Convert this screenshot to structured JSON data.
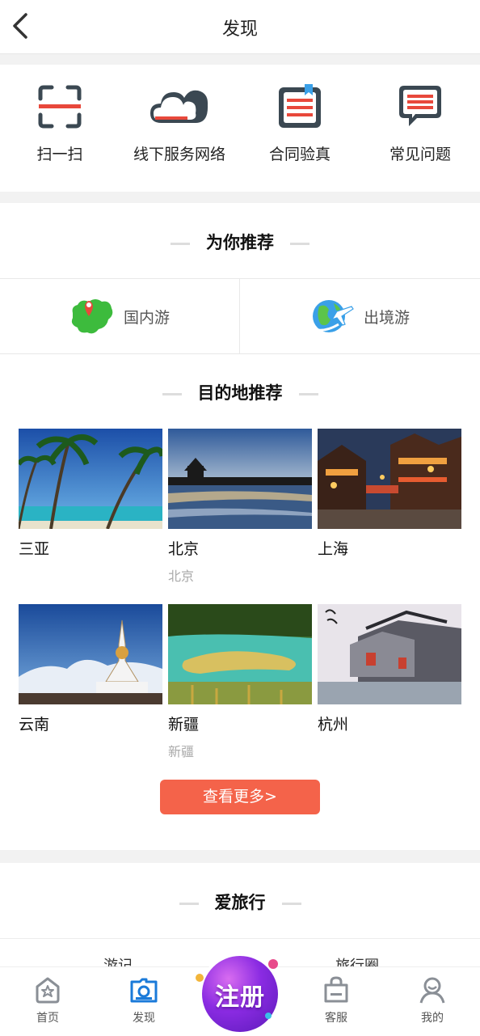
{
  "header": {
    "title": "发现"
  },
  "tools": [
    {
      "label": "扫一扫",
      "icon": "scan-icon"
    },
    {
      "label": "线下服务网络",
      "icon": "cloud-icon"
    },
    {
      "label": "合同验真",
      "icon": "contract-icon"
    },
    {
      "label": "常见问题",
      "icon": "faq-icon"
    }
  ],
  "recommend": {
    "title": "为你推荐",
    "tabs": [
      {
        "label": "国内游",
        "icon": "china-map-icon"
      },
      {
        "label": "出境游",
        "icon": "globe-plane-icon"
      }
    ]
  },
  "destinations": {
    "title": "目的地推荐",
    "items": [
      {
        "name": "三亚",
        "sub": ""
      },
      {
        "name": "北京",
        "sub": "北京"
      },
      {
        "name": "上海",
        "sub": ""
      },
      {
        "name": "云南",
        "sub": ""
      },
      {
        "name": "新疆",
        "sub": "新疆"
      },
      {
        "name": "杭州",
        "sub": ""
      }
    ],
    "more_label": "查看更多>"
  },
  "love_travel": {
    "title": "爱旅行",
    "tabs": [
      "游记",
      "旅行圈"
    ]
  },
  "tabbar": {
    "items": [
      {
        "label": "首页",
        "icon": "home-icon"
      },
      {
        "label": "发现",
        "icon": "discover-icon"
      },
      {
        "label": "客服",
        "icon": "service-bag-icon"
      },
      {
        "label": "我的",
        "icon": "user-icon"
      }
    ],
    "register_label": "注册"
  },
  "colors": {
    "accent": "#f4634a",
    "icon_red": "#e8483b",
    "icon_dark": "#3b4852",
    "tab_active": "#1a7ad9"
  }
}
